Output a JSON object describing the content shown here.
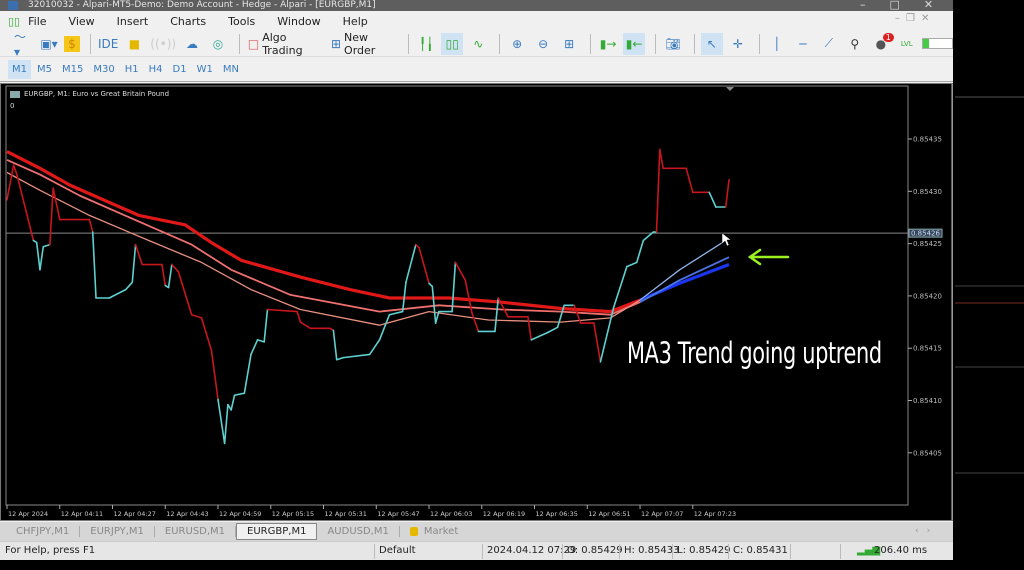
{
  "window": {
    "title": "32010032 - Alpari-MT5-Demo: Demo Account - Hedge - Alpari - [EURGBP,M1]"
  },
  "menu": [
    "File",
    "View",
    "Insert",
    "Charts",
    "Tools",
    "Window",
    "Help"
  ],
  "toolbar": {
    "algo_trading": "Algo Trading",
    "new_order": "New Order",
    "ide": "IDE",
    "notification_count": "1",
    "lvl": "LVL"
  },
  "timeframes": {
    "items": [
      "M1",
      "M5",
      "M15",
      "M30",
      "H1",
      "H4",
      "D1",
      "W1",
      "MN"
    ],
    "selected": "M1"
  },
  "chart": {
    "title": "EURGBP, M1:  Euro vs Great Britain Pound",
    "indicator_value": "0",
    "annotation": "MA3 Trend going uptrend",
    "current_price_label": "0.85426"
  },
  "chart_data": {
    "type": "line",
    "symbol": "EURGBP",
    "timeframe": "M1",
    "x_start": "03:55",
    "x_tick_labels": [
      "12 Apr 2024",
      "12 Apr 04:11",
      "12 Apr 04:27",
      "12 Apr 04:43",
      "12 Apr 04:59",
      "12 Apr 05:15",
      "12 Apr 05:31",
      "12 Apr 05:47",
      "12 Apr 06:03",
      "12 Apr 06:19",
      "12 Apr 06:35",
      "12 Apr 06:51",
      "12 Apr 07:07",
      "12 Apr 07:23"
    ],
    "y_ticks": [
      "0.85435",
      "0.85430",
      "0.85425",
      "0.85420",
      "0.85415",
      "0.85410",
      "0.85405"
    ],
    "ylim": [
      0.85399,
      0.85439
    ],
    "current_price": 0.85426,
    "colors": {
      "down": "#c8161c",
      "up": "#5fd0d0",
      "ma_fast_red": "#e88f80",
      "ma_mid_red": "#f07070",
      "ma_slow_red": "#e01818",
      "ma_fast_blue": "#8fb4e8",
      "ma_mid_blue": "#4a74e6",
      "ma_slow_blue": "#1a36f0",
      "arrow": "#9cf020"
    },
    "price_line": [
      [
        "03:55",
        0.854292,
        "down"
      ],
      [
        "03:57",
        0.854325,
        "down"
      ],
      [
        "03:58",
        0.854316,
        "down"
      ],
      [
        "04:03",
        0.854253,
        "up"
      ],
      [
        "04:04",
        0.854251,
        "up"
      ],
      [
        "04:05",
        0.854225,
        "up"
      ],
      [
        "04:06",
        0.854247,
        "up"
      ],
      [
        "04:08",
        0.854249,
        "down"
      ],
      [
        "04:09",
        0.854303,
        "down"
      ],
      [
        "04:11",
        0.854273,
        "down"
      ],
      [
        "04:20",
        0.854273,
        "down"
      ],
      [
        "04:21",
        0.854261,
        "up"
      ],
      [
        "04:22",
        0.854198,
        "up"
      ],
      [
        "04:26",
        0.854198,
        "up"
      ],
      [
        "04:31",
        0.854206,
        "up"
      ],
      [
        "04:33",
        0.854213,
        "up"
      ],
      [
        "04:34",
        0.854249,
        "down"
      ],
      [
        "04:36",
        0.85423,
        "down"
      ],
      [
        "04:42",
        0.85423,
        "down"
      ],
      [
        "04:43",
        0.85421,
        "up"
      ],
      [
        "04:44",
        0.854208,
        "up"
      ],
      [
        "04:45",
        0.85423,
        "down"
      ],
      [
        "04:47",
        0.854223,
        "down"
      ],
      [
        "04:51",
        0.854182,
        "down"
      ],
      [
        "04:54",
        0.854179,
        "down"
      ],
      [
        "04:57",
        0.854148,
        "down"
      ],
      [
        "04:59",
        0.854101,
        "up"
      ],
      [
        "05:01",
        0.854059,
        "up"
      ],
      [
        "05:02",
        0.854096,
        "up"
      ],
      [
        "05:03",
        0.854091,
        "up"
      ],
      [
        "05:04",
        0.854105,
        "up"
      ],
      [
        "05:07",
        0.854107,
        "up"
      ],
      [
        "05:09",
        0.854144,
        "up"
      ],
      [
        "05:11",
        0.854158,
        "up"
      ],
      [
        "05:13",
        0.854156,
        "up"
      ],
      [
        "05:14",
        0.854187,
        "down"
      ],
      [
        "05:23",
        0.854185,
        "down"
      ],
      [
        "05:24",
        0.854175,
        "down"
      ],
      [
        "05:27",
        0.854169,
        "down"
      ],
      [
        "05:33",
        0.854169,
        "down"
      ],
      [
        "05:34",
        0.854167,
        "up"
      ],
      [
        "05:35",
        0.854139,
        "up"
      ],
      [
        "05:37",
        0.854141,
        "up"
      ],
      [
        "05:45",
        0.854144,
        "up"
      ],
      [
        "05:48",
        0.854158,
        "up"
      ],
      [
        "05:51",
        0.854182,
        "up"
      ],
      [
        "05:55",
        0.854185,
        "up"
      ],
      [
        "05:56",
        0.854213,
        "up"
      ],
      [
        "05:59",
        0.854249,
        "down"
      ],
      [
        "06:00",
        0.854246,
        "down"
      ],
      [
        "06:03",
        0.854212,
        "up"
      ],
      [
        "06:04",
        0.854209,
        "up"
      ],
      [
        "06:05",
        0.854174,
        "up"
      ],
      [
        "06:06",
        0.854185,
        "up"
      ],
      [
        "06:10",
        0.854185,
        "up"
      ],
      [
        "06:11",
        0.854232,
        "down"
      ],
      [
        "06:14",
        0.854215,
        "down"
      ],
      [
        "06:16",
        0.854184,
        "down"
      ],
      [
        "06:18",
        0.854166,
        "up"
      ],
      [
        "06:23",
        0.854166,
        "up"
      ],
      [
        "06:24",
        0.854198,
        "down"
      ],
      [
        "06:27",
        0.85418,
        "down"
      ],
      [
        "06:33",
        0.85418,
        "down"
      ],
      [
        "06:34",
        0.854158,
        "up"
      ],
      [
        "06:39",
        0.854165,
        "up"
      ],
      [
        "06:42",
        0.85417,
        "up"
      ],
      [
        "06:44",
        0.854191,
        "up"
      ],
      [
        "06:47",
        0.854191,
        "down"
      ],
      [
        "06:49",
        0.854174,
        "down"
      ],
      [
        "06:53",
        0.854174,
        "down"
      ],
      [
        "06:55",
        0.854137,
        "up"
      ],
      [
        "06:59",
        0.854189,
        "up"
      ],
      [
        "07:03",
        0.854228,
        "up"
      ],
      [
        "07:06",
        0.854232,
        "up"
      ],
      [
        "07:08",
        0.854253,
        "up"
      ],
      [
        "07:11",
        0.854261,
        "up"
      ],
      [
        "07:12",
        0.854261,
        "down"
      ],
      [
        "07:13",
        0.85434,
        "down"
      ],
      [
        "07:14",
        0.854322,
        "down"
      ],
      [
        "07:21",
        0.854322,
        "down"
      ],
      [
        "07:23",
        0.854299,
        "down"
      ],
      [
        "07:28",
        0.854299,
        "up"
      ],
      [
        "07:30",
        0.854285,
        "up"
      ],
      [
        "07:33",
        0.854285,
        "down"
      ],
      [
        "07:34",
        0.854311,
        "down"
      ]
    ],
    "ma_lines": [
      {
        "key": "slow",
        "points": [
          [
            "03:55",
            0.854338
          ],
          [
            "04:05",
            0.854322
          ],
          [
            "04:14",
            0.854306
          ],
          [
            "04:35",
            0.854277
          ],
          [
            "04:49",
            0.854268
          ],
          [
            "04:57",
            0.854251
          ],
          [
            "05:06",
            0.854234
          ],
          [
            "05:24",
            0.854218
          ],
          [
            "05:39",
            0.854206
          ],
          [
            "05:51",
            0.854198
          ],
          [
            "06:09",
            0.854198
          ],
          [
            "06:25",
            0.854194
          ],
          [
            "06:43",
            0.854188
          ],
          [
            "06:58",
            0.854185
          ],
          [
            "07:07",
            0.854196
          ],
          [
            "07:19",
            0.854212
          ],
          [
            "07:34",
            0.85423
          ]
        ],
        "turns_blue_at": "07:07"
      },
      {
        "key": "mid",
        "points": [
          [
            "03:55",
            0.85433
          ],
          [
            "04:05",
            0.854316
          ],
          [
            "04:17",
            0.854296
          ],
          [
            "04:35",
            0.854271
          ],
          [
            "04:51",
            0.854249
          ],
          [
            "05:03",
            0.854225
          ],
          [
            "05:21",
            0.854201
          ],
          [
            "05:48",
            0.854185
          ],
          [
            "06:06",
            0.854191
          ],
          [
            "06:25",
            0.854187
          ],
          [
            "06:43",
            0.854185
          ],
          [
            "06:58",
            0.854182
          ],
          [
            "07:07",
            0.854194
          ],
          [
            "07:19",
            0.854215
          ],
          [
            "07:34",
            0.854237
          ]
        ],
        "turns_blue_at": "07:07"
      },
      {
        "key": "fast",
        "points": [
          [
            "03:55",
            0.854318
          ],
          [
            "04:05",
            0.854301
          ],
          [
            "04:20",
            0.854277
          ],
          [
            "04:38",
            0.854253
          ],
          [
            "04:54",
            0.854232
          ],
          [
            "05:09",
            0.854206
          ],
          [
            "05:24",
            0.854187
          ],
          [
            "05:48",
            0.854172
          ],
          [
            "06:03",
            0.854185
          ],
          [
            "06:21",
            0.854177
          ],
          [
            "06:43",
            0.854175
          ],
          [
            "06:58",
            0.854179
          ],
          [
            "07:07",
            0.854196
          ],
          [
            "07:19",
            0.854225
          ],
          [
            "07:32",
            0.854251
          ]
        ],
        "turns_blue_at": "07:07"
      }
    ]
  },
  "tabs": {
    "items": [
      "CHFJPY,M1",
      "EURJPY,M1",
      "EURUSD,M1",
      "EURGBP,M1",
      "AUDUSD,M1"
    ],
    "selected": "EURGBP,M1",
    "market": "Market"
  },
  "status": {
    "help": "For Help, press F1",
    "profile": "Default",
    "datetime": "2024.04.12 07:29",
    "open": "O: 0.85429",
    "high": "H: 0.85433",
    "low": "L: 0.85429",
    "close": "C: 0.85431",
    "ping": "206.40 ms"
  }
}
